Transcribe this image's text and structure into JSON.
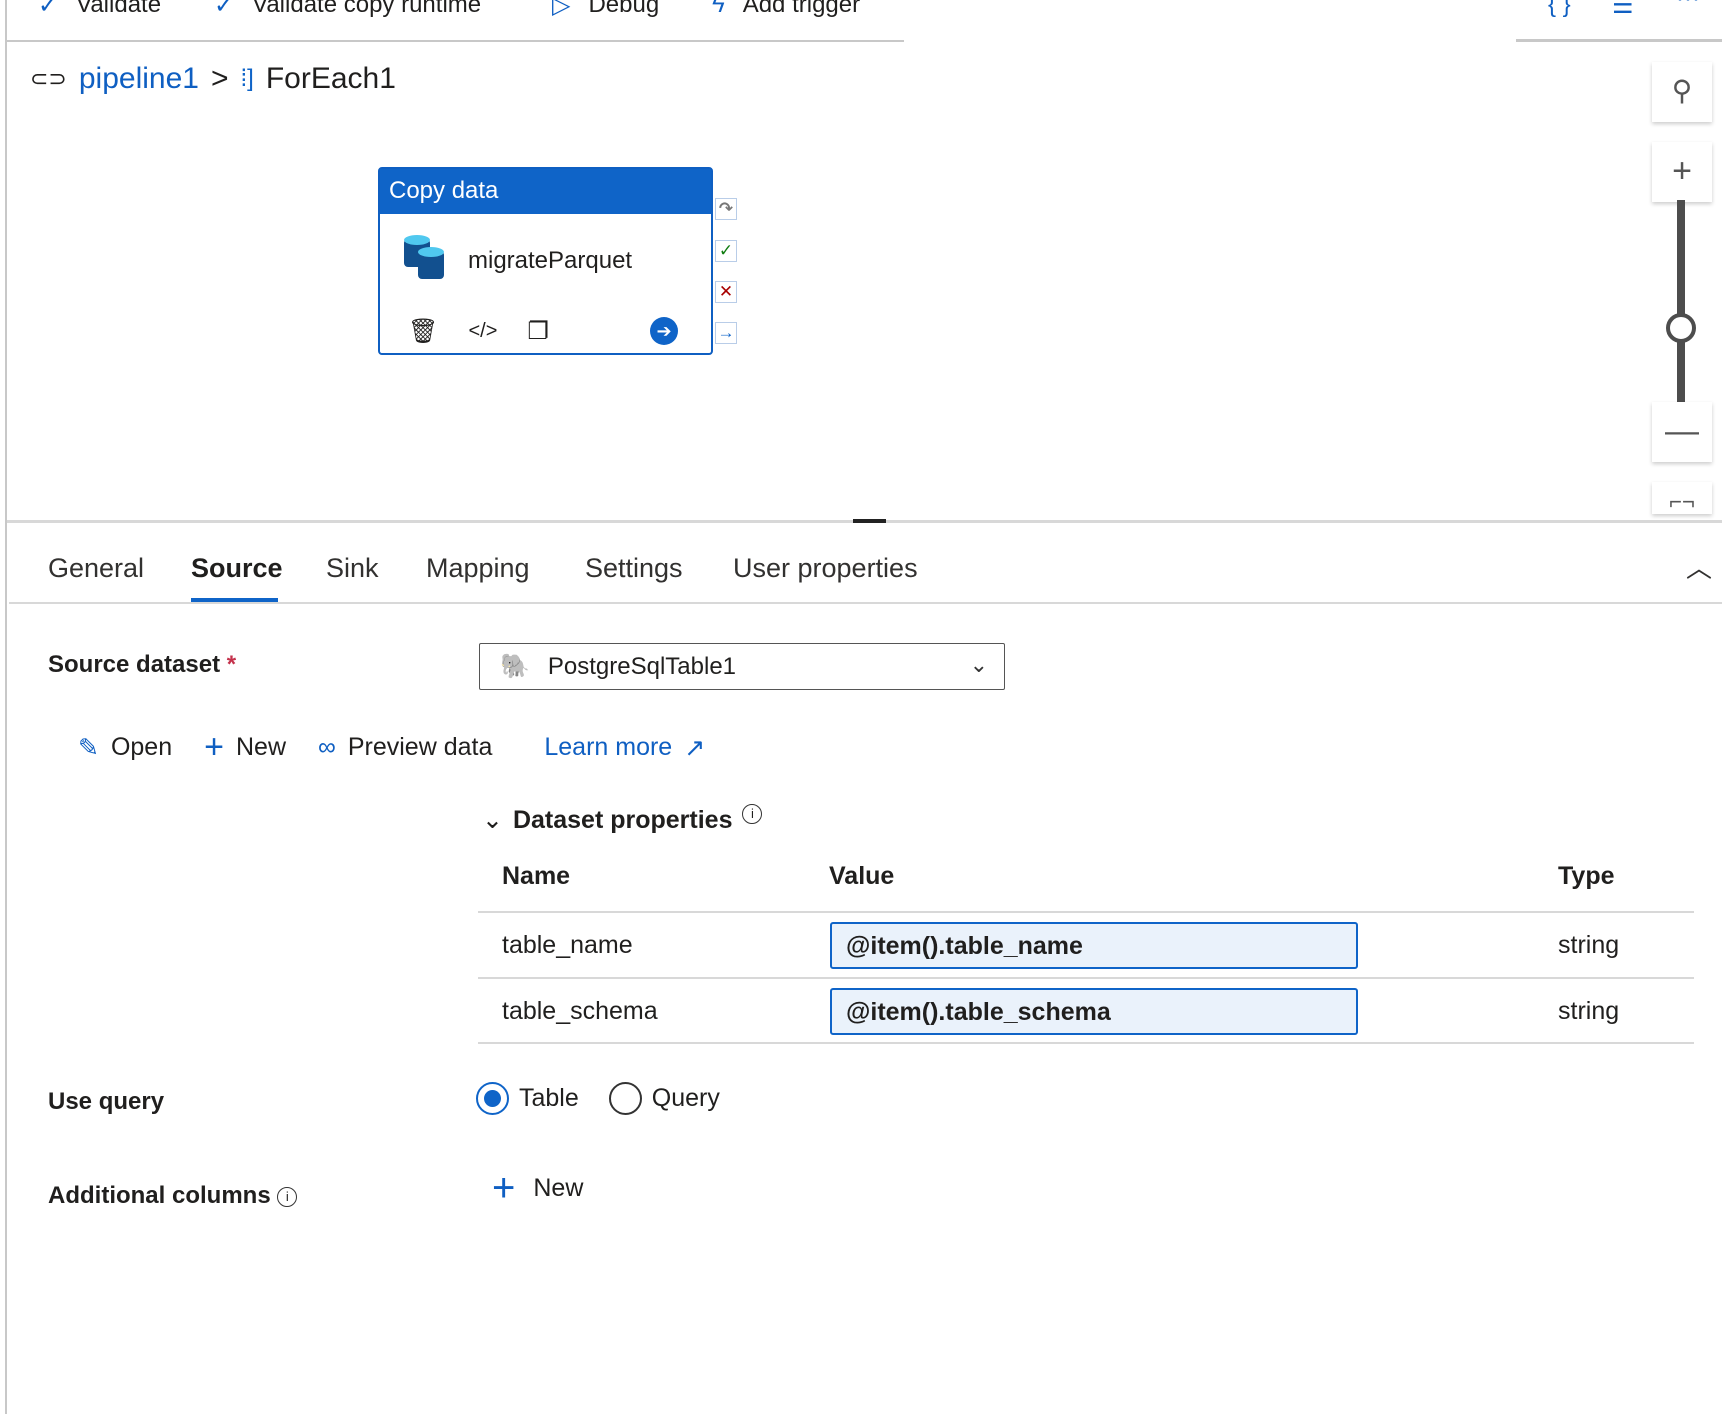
{
  "toolbar": {
    "items": [
      {
        "icon": "checkmark-icon",
        "label": "Validate"
      },
      {
        "icon": "checkmark-icon",
        "label": "Validate copy runtime"
      },
      {
        "icon": "play-icon",
        "label": "Debug"
      },
      {
        "icon": "trigger-icon",
        "label": "Add trigger"
      }
    ],
    "right_icons": [
      "code-braces-icon",
      "properties-settings-icon",
      "more-icon"
    ]
  },
  "breadcrumb": {
    "pipeline": "pipeline1",
    "separator": ">",
    "activity": "ForEach1"
  },
  "activity": {
    "type": "Copy data",
    "name": "migrateParquet"
  },
  "tabs": [
    "General",
    "Source",
    "Sink",
    "Mapping",
    "Settings",
    "User properties"
  ],
  "selected_tab": "Source",
  "source": {
    "dataset_label": "Source dataset",
    "required_mark": "*",
    "dataset_value": "PostgreSqlTable1",
    "actions": {
      "open": "Open",
      "new": "New",
      "preview": "Preview data",
      "learn": "Learn more"
    },
    "dataset_properties": {
      "title": "Dataset properties",
      "columns": [
        "Name",
        "Value",
        "Type"
      ],
      "rows": [
        {
          "name": "table_name",
          "value": "@item().table_name",
          "type": "string"
        },
        {
          "name": "table_schema",
          "value": "@item().table_schema",
          "type": "string"
        }
      ]
    },
    "use_query": {
      "label": "Use query",
      "options": [
        "Table",
        "Query"
      ],
      "selected": "Table"
    },
    "additional_columns": {
      "label": "Additional columns",
      "new": "New"
    }
  },
  "colors": {
    "accent": "#0f64c8",
    "link": "#0f5fc2",
    "required": "#c4314b"
  }
}
